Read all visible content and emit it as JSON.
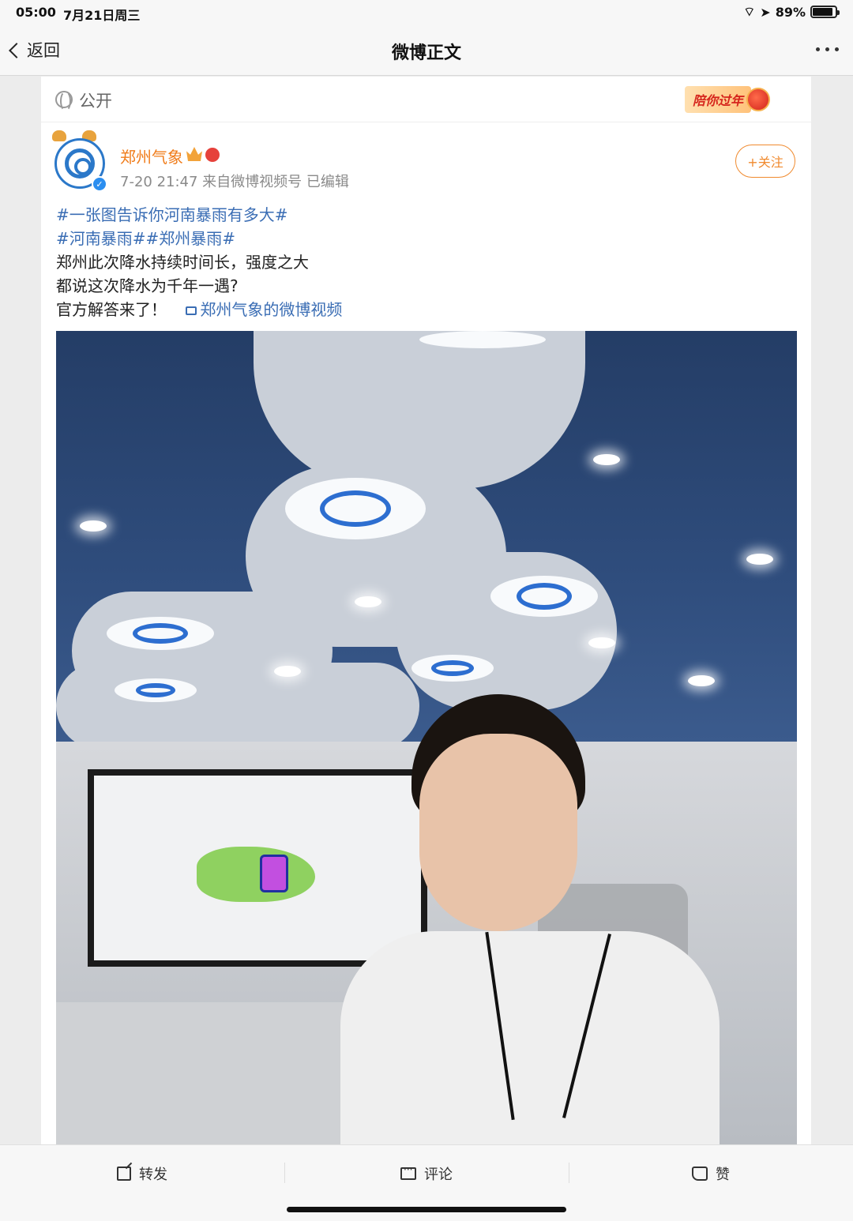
{
  "status_bar": {
    "time": "05:00",
    "date": "7月21日周三",
    "battery": "89%",
    "battery_level": 0.89
  },
  "nav": {
    "back_label": "返回",
    "title": "微博正文"
  },
  "visibility": {
    "label": "公开",
    "banner_text": "陪你过年"
  },
  "post": {
    "author": "郑州气象",
    "meta": "7-20 21:47  来自微博视频号  已编辑",
    "follow_label": "+关注",
    "lines": [
      {
        "hashtag": "#一张图告诉你河南暴雨有多大#"
      },
      {
        "hashtag": "#河南暴雨##郑州暴雨#"
      },
      {
        "text": "郑州此次降水持续时间长，强度之大"
      },
      {
        "text": "都说这次降水为千年一遇?"
      },
      {
        "text": "官方解答来了！",
        "link": "郑州气象的微博视频"
      }
    ]
  },
  "actions": {
    "repost": "转发",
    "comment": "评论",
    "like": "赞"
  },
  "colors": {
    "accent_orange": "#f07c1a",
    "link_blue": "#3a6db4"
  }
}
